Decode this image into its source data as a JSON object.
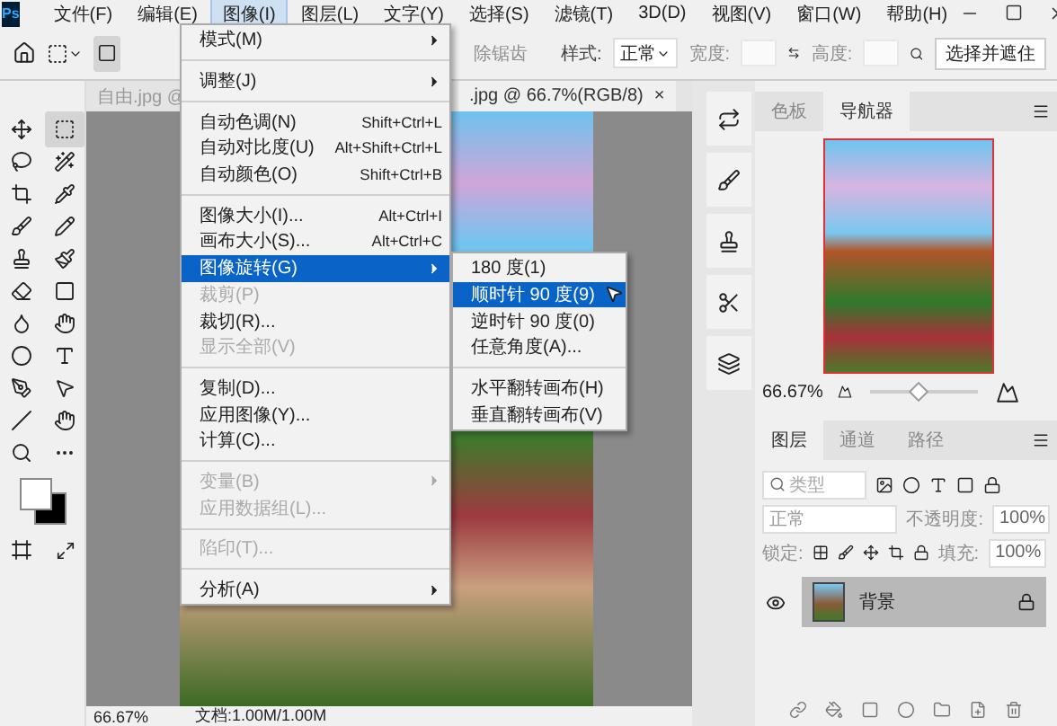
{
  "menu_bar": {
    "logo": "Ps",
    "items": [
      {
        "label": "文件(F)",
        "selected": false
      },
      {
        "label": "编辑(E)",
        "selected": false
      },
      {
        "label": "图像(I)",
        "selected": true
      },
      {
        "label": "图层(L)",
        "selected": false
      },
      {
        "label": "文字(Y)",
        "selected": false
      },
      {
        "label": "选择(S)",
        "selected": false
      },
      {
        "label": "滤镜(T)",
        "selected": false
      },
      {
        "label": "3D(D)",
        "selected": false
      },
      {
        "label": "视图(V)",
        "selected": false
      },
      {
        "label": "窗口(W)",
        "selected": false
      },
      {
        "label": "帮助(H)",
        "selected": false
      }
    ]
  },
  "options_bar": {
    "antialias": "除锯齿",
    "style_label": "样式:",
    "style_value": "正常",
    "width_label": "宽度:",
    "height_label": "高度:",
    "mask_button": "选择并遮住"
  },
  "document_tabs": [
    {
      "label": "自由.jpg @",
      "selected": false
    },
    {
      "label": ".jpg @ 66.7%(RGB/8)",
      "selected": true,
      "close": "×"
    }
  ],
  "image_menu": {
    "items": [
      {
        "kind": "submenu",
        "label": "模式(M)",
        "disabled": false,
        "selected": false
      },
      {
        "kind": "separator"
      },
      {
        "kind": "submenu",
        "label": "调整(J)",
        "disabled": false,
        "selected": false
      },
      {
        "kind": "separator"
      },
      {
        "kind": "item",
        "label": "自动色调(N)",
        "shortcut": "Shift+Ctrl+L",
        "disabled": false,
        "selected": false
      },
      {
        "kind": "item",
        "label": "自动对比度(U)",
        "shortcut": "Alt+Shift+Ctrl+L",
        "disabled": false,
        "selected": false
      },
      {
        "kind": "item",
        "label": "自动颜色(O)",
        "shortcut": "Shift+Ctrl+B",
        "disabled": false,
        "selected": false
      },
      {
        "kind": "separator"
      },
      {
        "kind": "item",
        "label": "图像大小(I)...",
        "shortcut": "Alt+Ctrl+I",
        "disabled": false,
        "selected": false
      },
      {
        "kind": "item",
        "label": "画布大小(S)...",
        "shortcut": "Alt+Ctrl+C",
        "disabled": false,
        "selected": false
      },
      {
        "kind": "submenu",
        "label": "图像旋转(G)",
        "disabled": false,
        "selected": true
      },
      {
        "kind": "item",
        "label": "裁剪(P)",
        "disabled": true,
        "selected": false
      },
      {
        "kind": "item",
        "label": "裁切(R)...",
        "disabled": false,
        "selected": false
      },
      {
        "kind": "item",
        "label": "显示全部(V)",
        "disabled": true,
        "selected": false
      },
      {
        "kind": "separator"
      },
      {
        "kind": "item",
        "label": "复制(D)...",
        "disabled": false,
        "selected": false
      },
      {
        "kind": "item",
        "label": "应用图像(Y)...",
        "disabled": false,
        "selected": false
      },
      {
        "kind": "item",
        "label": "计算(C)...",
        "disabled": false,
        "selected": false
      },
      {
        "kind": "separator"
      },
      {
        "kind": "submenu",
        "label": "变量(B)",
        "disabled": true,
        "selected": false
      },
      {
        "kind": "item",
        "label": "应用数据组(L)...",
        "disabled": true,
        "selected": false
      },
      {
        "kind": "separator"
      },
      {
        "kind": "item",
        "label": "陷印(T)...",
        "disabled": true,
        "selected": false
      },
      {
        "kind": "separator"
      },
      {
        "kind": "submenu",
        "label": "分析(A)",
        "disabled": false,
        "selected": false
      }
    ]
  },
  "rotate_submenu": {
    "items": [
      {
        "kind": "item",
        "label": "180 度(1)",
        "selected": false
      },
      {
        "kind": "item",
        "label": "顺时针 90 度(9)",
        "selected": true
      },
      {
        "kind": "item",
        "label": "逆时针 90 度(0)",
        "selected": false
      },
      {
        "kind": "item",
        "label": "任意角度(A)...",
        "selected": false
      },
      {
        "kind": "separator"
      },
      {
        "kind": "item",
        "label": "水平翻转画布(H)",
        "selected": false
      },
      {
        "kind": "item",
        "label": "垂直翻转画布(V)",
        "selected": false
      }
    ]
  },
  "status_bar": {
    "zoom": "66.67%",
    "doc_info": "文档:1.00M/1.00M"
  },
  "navigator": {
    "tabs": [
      {
        "label": "色板",
        "selected": false
      },
      {
        "label": "导航器",
        "selected": true
      }
    ],
    "zoom": "66.67%",
    "zoom_slider": {
      "level": 0.45
    }
  },
  "layers_panel": {
    "tabs": [
      {
        "label": "图层",
        "selected": true
      },
      {
        "label": "通道",
        "selected": false
      },
      {
        "label": "路径",
        "selected": false
      }
    ],
    "filter_placeholder": "类型",
    "blend_mode": "正常",
    "opacity_label": "不透明度:",
    "opacity_value": "100%",
    "lock_label": "锁定:",
    "fill_label": "填充:",
    "fill_value": "100%",
    "layers": [
      {
        "name": "背景",
        "visible": true,
        "locked": true,
        "selected": true
      }
    ]
  }
}
